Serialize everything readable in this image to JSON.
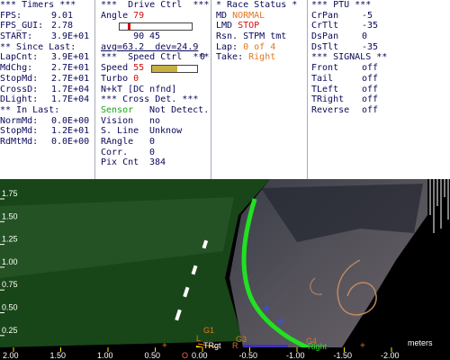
{
  "timers": {
    "header": "*** Timers ***",
    "fps_label": "FPS:",
    "fps": "9.01",
    "fps_gui_label": "FPS_GUI:",
    "fps_gui": "2.78",
    "start_label": "START:",
    "start": "3.9E+01",
    "since_last_header": "** Since Last:",
    "lapcnt_label": "LapCnt:",
    "lapcnt": "3.9E+01",
    "mdchg_label": "MdChg:",
    "mdchg": "2.7E+01",
    "stopmd_label": "StopMd:",
    "stopmd": "2.7E+01",
    "crossd_label": "CrossD:",
    "crossd": "1.7E+04",
    "dlight_label": "DLight:",
    "dlight": "1.7E+04",
    "in_last_header": "** In Last:",
    "normmd_label": "NormMd:",
    "normmd": "0.0E+00",
    "stopmd2_label": "StopMd:",
    "stopmd2": "1.2E+01",
    "rdmtmd_label": "RdMtMd:",
    "rdmtmd": "0.0E+00"
  },
  "drive": {
    "header": "***  Drive Ctrl  ***",
    "angle_label": "Angle",
    "angle": "79",
    "gauge_min": "90",
    "gauge_max": "0",
    "gauge_level": 0.12,
    "gauge_value": "45",
    "avg_dev": "avg=63.2  dev=24.9",
    "speed_header": "***  Speed Ctrl  ***",
    "speed_label": "Speed",
    "speed": "55",
    "speed_level": 0.55,
    "turbo_label": "Turbo",
    "turbo": "0",
    "nkt": "N+kT [DC nfnd]",
    "cross_header": "*** Cross Det. ***",
    "sensor_label": "Sensor",
    "sensor": "Not Detect.",
    "vision_label": "Vision",
    "vision": "no",
    "sline_label": "S. Line",
    "sline": "Unknow",
    "rangle_label": "RAngle",
    "rangle": "0",
    "corr_label": "Corr.",
    "corr": "0",
    "pixcnt_label": "Pix Cnt",
    "pixcnt": "384"
  },
  "race": {
    "header": "* Race Status *",
    "md_label": "MD",
    "md": "NORMAL",
    "lmd_label": "LMD",
    "lmd": "STOP",
    "rsn_label": "Rsn.",
    "rsn": "STPM tmt",
    "lap_label": "Lap:",
    "lap": "0 of 4",
    "take_label": "Take:",
    "take": "Right"
  },
  "ptu": {
    "header": "*** PTU ***",
    "crpan_label": "CrPan",
    "crpan": "-5",
    "crtilt_label": "CrTlt",
    "crtilt": "-35",
    "dspan_label": "DsPan",
    "dspan": "0",
    "dstilt_label": "DsTlt",
    "dstilt": "-35",
    "signals_header": "*** SIGNALS **",
    "front_label": "Front",
    "front": "off",
    "tail_label": "Tail",
    "tail": "off",
    "tleft_label": "TLeft",
    "tleft": "off",
    "tright_label": "TRight",
    "tright": "off",
    "reverse_label": "Reverse",
    "reverse": "off"
  },
  "view": {
    "y_ticks": [
      "1.75",
      "1.50",
      "1.25",
      "1.00",
      "0.75",
      "0.50",
      "0.25",
      "0.00"
    ],
    "x_ticks": [
      "2.00",
      "1.50",
      "1.00",
      "0.50",
      "0.00",
      "-0.50",
      "-1.00",
      "-1.50",
      "-2.00"
    ],
    "units": "meters",
    "label_g1": "G1",
    "label_g3": "G3",
    "label_trgt": "TRgt",
    "label_g4": "G4",
    "label_right": "Right",
    "label_l": "L",
    "label_r": "R",
    "label_o": "O"
  },
  "colors": {
    "header_text": "#0a0a5a",
    "red_value": "#d01010",
    "orange_value": "#e07820",
    "green_value": "#12a812",
    "trace_green": "#22e022",
    "tick_yellow": "#ffe000"
  }
}
